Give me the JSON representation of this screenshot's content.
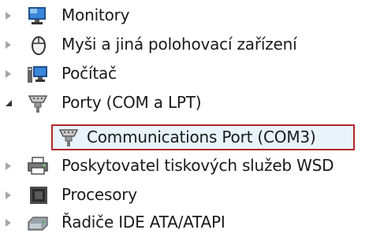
{
  "tree": {
    "items": [
      {
        "label": "Monitory",
        "icon": "monitor-icon",
        "expanded": false
      },
      {
        "label": "Myši a jiná polohovací zařízení",
        "icon": "mouse-icon",
        "expanded": false
      },
      {
        "label": "Počítač",
        "icon": "computer-icon",
        "expanded": false
      },
      {
        "label": "Porty (COM a LPT)",
        "icon": "port-icon",
        "expanded": true,
        "children": [
          {
            "label": "Communications Port (COM3)",
            "icon": "port-icon",
            "selected": true
          }
        ]
      },
      {
        "label": "Poskytovatel tiskových služeb WSD",
        "icon": "printer-icon",
        "expanded": false
      },
      {
        "label": "Procesory",
        "icon": "processor-icon",
        "expanded": false
      },
      {
        "label": "Řadiče IDE ATA/ATAPI",
        "icon": "ide-controller-icon",
        "expanded": false
      }
    ]
  },
  "colors": {
    "selection_border": "#b3262a",
    "selection_fill": "#e8f3fc",
    "text": "#1a1a1a"
  }
}
